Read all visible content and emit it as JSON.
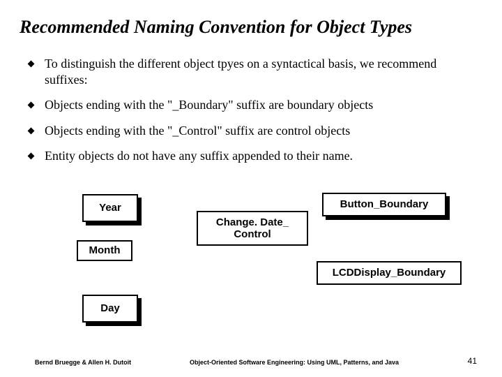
{
  "title": "Recommended Naming Convention for Object Types",
  "bullets": [
    "To distinguish the different object tpyes on a syntactical basis, we recommend suffixes:",
    "Objects ending with the \"_Boundary\" suffix are boundary objects",
    "Objects ending with the \"_Control\" suffix are control objects",
    "Entity objects do not have any suffix appended to their name."
  ],
  "boxes": {
    "year": "Year",
    "month": "Month",
    "day": "Day",
    "control": "Change. Date_ Control",
    "button": "Button_Boundary",
    "lcd": "LCDDisplay_Boundary"
  },
  "footer": {
    "authors": "Bernd Bruegge & Allen H. Dutoit",
    "book": "Object-Oriented Software Engineering: Using UML, Patterns, and Java",
    "page": "41"
  }
}
